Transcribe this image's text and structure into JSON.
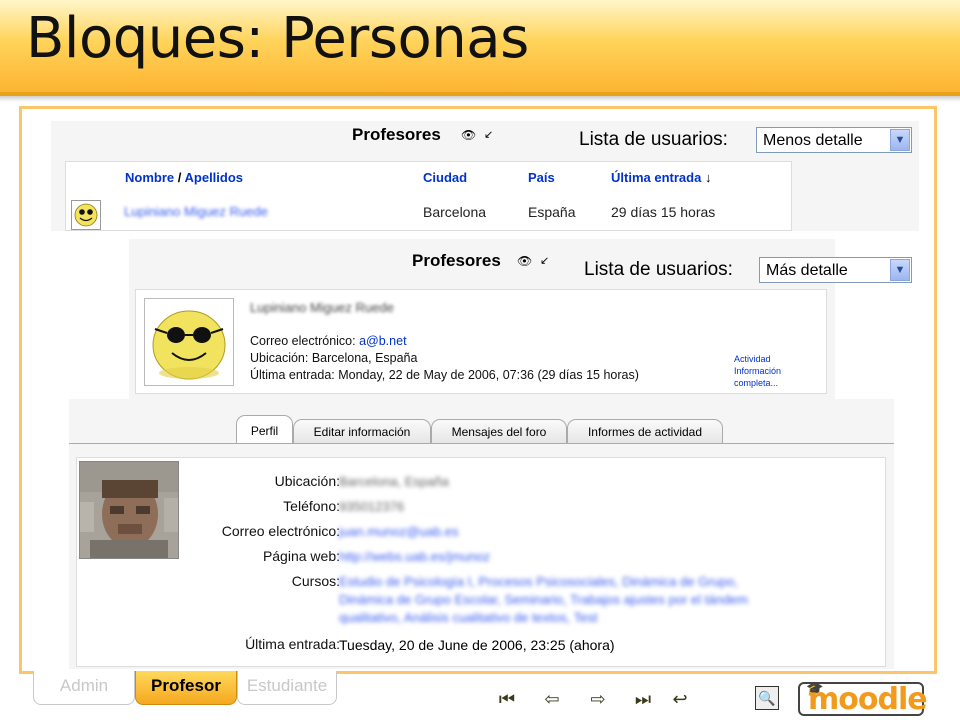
{
  "slide": {
    "title": "Bloques: Personas"
  },
  "panel_menos": {
    "block_title": "Profesores",
    "list_label": "Lista de usuarios:",
    "select_value": "Menos detalle",
    "columns": {
      "nombre": "Nombre",
      "sep": "/",
      "apellidos": "Apellidos",
      "ciudad": "Ciudad",
      "pais": "País",
      "ultima": "Última entrada",
      "sort_arrow": "↓"
    },
    "row": {
      "name": "Lupiniano Miguez Ruede",
      "ciudad": "Barcelona",
      "pais": "España",
      "ultima": "29 días 15 horas"
    }
  },
  "panel_mas": {
    "block_title": "Profesores",
    "list_label": "Lista de usuarios:",
    "select_value": "Más detalle",
    "name": "Lupiniano Miguez Ruede",
    "email_label": "Correo electrónico:",
    "email": "a@b.net",
    "ubicacion": "Ubicación: Barcelona, España",
    "ultima": "Última entrada: Monday, 22 de May de 2006, 07:36  (29 días 15 horas)",
    "link_actividad": "Actividad",
    "link_info": "Información",
    "link_completa": "completa..."
  },
  "profile": {
    "tabs": [
      "Perfil",
      "Editar información",
      "Mensajes del foro",
      "Informes de actividad"
    ],
    "labels": {
      "ubicacion": "Ubicación:",
      "telefono": "Teléfono:",
      "correo": "Correo electrónico:",
      "web": "Página web:",
      "cursos": "Cursos:",
      "ultima": "Última entrada:"
    },
    "values": {
      "ubicacion": "Barcelona, España",
      "telefono": "935012376",
      "correo": "juan.munoz@uab.es",
      "web": "http://webs.uab.es/jmunoz",
      "cursos_1": "Estudio de Psicología I, Procesos Psicosociales, Dinámica de Grupo,",
      "cursos_2": "Dinámica de Grupo Escolar, Seminario, Trabajos ajustes por el tándem",
      "cursos_3": "qualitativo, Análisis cualitativo de textos, Test",
      "ultima": "Tuesday, 20 de June de 2006, 23:25  (ahora)"
    }
  },
  "roles": {
    "admin": "Admin",
    "profesor": "Profesor",
    "estudiante": "Estudiante"
  },
  "nav": {
    "first": "⏮",
    "prev": "⇦",
    "next": "⇨",
    "last": "⏭",
    "back": "↩"
  },
  "logo": {
    "text": "moodle"
  },
  "colors": {
    "banner": "#ffd35a",
    "frame": "#fbc56b",
    "link": "#0033cc",
    "active_role": "#f5a81f"
  }
}
